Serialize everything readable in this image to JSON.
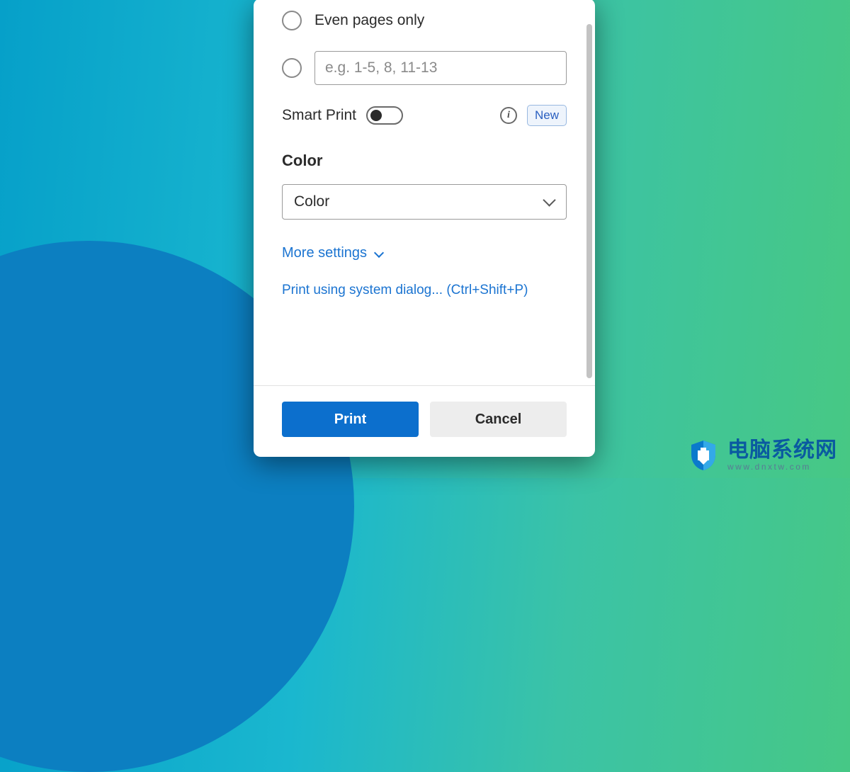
{
  "pages": {
    "even_label": "Even pages only",
    "custom_placeholder": "e.g. 1-5, 8, 11-13"
  },
  "smart_print": {
    "label": "Smart Print",
    "badge": "New"
  },
  "color": {
    "heading": "Color",
    "value": "Color"
  },
  "links": {
    "more_settings": "More settings",
    "system_dialog": "Print using system dialog... (Ctrl+Shift+P)"
  },
  "footer": {
    "print": "Print",
    "cancel": "Cancel"
  },
  "watermark": {
    "title": "电脑系统网",
    "sub": "www.dnxtw.com"
  }
}
